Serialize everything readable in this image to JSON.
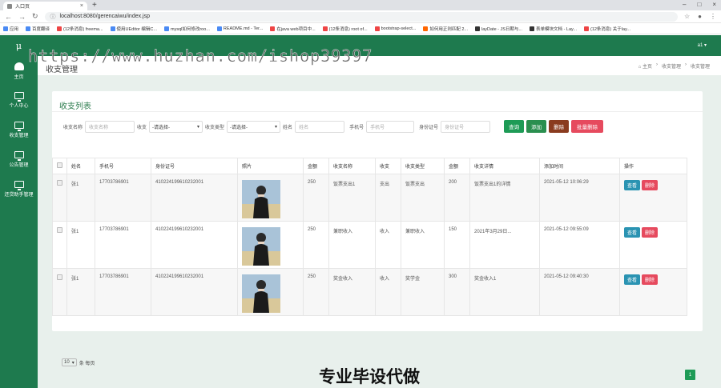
{
  "browser": {
    "tab_title": "入口页",
    "url": "localhost:8080/gerencaiwu/index.jsp",
    "bookmarks": [
      "应用",
      "百度翻译",
      "(12条消息) freema...",
      "使用UEditor 编辑C...",
      "mysql如何修改roo...",
      "README.md - Ter...",
      "在java web项目中...",
      "(12条消息) root of...",
      "bootstrap-select...",
      "如何用正则匹配 2...",
      "layDate - JS日期与...",
      "表单模块文档 - Lay...",
      "(12条消息) 关于lay..."
    ]
  },
  "app": {
    "logo": "μ",
    "user_label": "a1 ▾",
    "sidebar": [
      {
        "label": "主页",
        "icon": "home-icon"
      },
      {
        "label": "个人中心",
        "icon": "monitor-icon"
      },
      {
        "label": "收支管理",
        "icon": "monitor-icon"
      },
      {
        "label": "公告管理",
        "icon": "monitor-icon"
      },
      {
        "label": "还贷助手管理",
        "icon": "monitor-icon"
      }
    ],
    "page_title": "收支管理",
    "breadcrumb": [
      "⌂ 主页",
      "›",
      "收支管理",
      "›",
      "收支管理"
    ],
    "watermark": "https://www.huzhan.com/ishop39397"
  },
  "card": {
    "title": "收支列表",
    "search": {
      "name_label": "收支名称",
      "name_placeholder": "收支名称",
      "type_label": "收支",
      "type_value": "-请选择-",
      "category_label": "收支类型",
      "category_value": "-请选择-",
      "person_label": "姓名",
      "person_placeholder": "姓名",
      "phone_label": "手机号",
      "phone_placeholder": "手机号",
      "id_label": "身份证号",
      "id_placeholder": "身份证号"
    },
    "buttons": {
      "search": "查询",
      "add": "添加",
      "delete": "删除",
      "batch_delete": "批量删除"
    },
    "columns": [
      "",
      "姓名",
      "手机号",
      "身份证号",
      "照片",
      "金额",
      "收支名称",
      "收支",
      "收支类型",
      "金额",
      "收支详情",
      "添加时间",
      "操作"
    ],
    "rows": [
      {
        "name": "张1",
        "phone": "17703786901",
        "id": "410224199610232001",
        "amount": "250",
        "item_name": "饭票支出1",
        "type": "支出",
        "category": "饭票支出",
        "amount2": "200",
        "detail": "饭票支出1的详情",
        "time": "2021-05-12 10:06:29"
      },
      {
        "name": "张1",
        "phone": "17703786901",
        "id": "410224199610232001",
        "amount": "250",
        "item_name": "兼职收入",
        "type": "收入",
        "category": "兼职收入",
        "amount2": "150",
        "detail": "2021年3月29日...",
        "time": "2021-05-12 09:55:09"
      },
      {
        "name": "张1",
        "phone": "17703786901",
        "id": "410224199610232001",
        "amount": "250",
        "item_name": "奖金收入",
        "type": "收入",
        "category": "奖学金",
        "amount2": "300",
        "detail": "奖金收入1",
        "time": "2021-05-12 09:40:30"
      }
    ],
    "row_buttons": {
      "view": "查看",
      "delete": "删除"
    },
    "pager": {
      "size": "10",
      "suffix": "条 每页",
      "current_page": "1"
    }
  },
  "footer_text": "专业毕设代做",
  "colors": {
    "brand": "#1e7a4e",
    "primary": "#1e9b56",
    "danger": "#e64a5e",
    "info": "#2a93b2"
  }
}
